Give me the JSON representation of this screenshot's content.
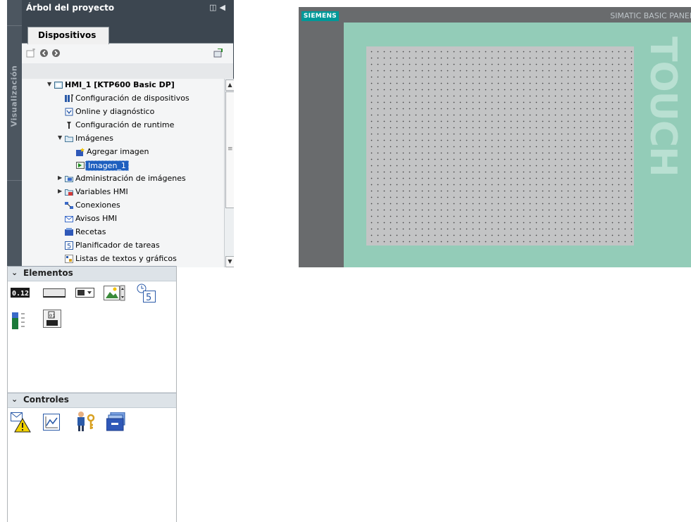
{
  "tree_panel": {
    "title": "Árbol del proyecto",
    "side_tab": "Visualización",
    "tab": "Dispositivos",
    "items": [
      {
        "label": "HMI_1 [KTP600 Basic DP]",
        "level": 0,
        "expander": "open",
        "icon": "hmi-device-icon"
      },
      {
        "label": "Configuración de dispositivos",
        "level": 1,
        "expander": "none",
        "icon": "device-config-icon"
      },
      {
        "label": "Online y diagnóstico",
        "level": 1,
        "expander": "none",
        "icon": "online-diagnostics-icon"
      },
      {
        "label": "Configuración de runtime",
        "level": 1,
        "expander": "none",
        "icon": "runtime-config-icon"
      },
      {
        "label": "Imágenes",
        "level": 1,
        "expander": "open",
        "icon": "folder-icon"
      },
      {
        "label": "Agregar imagen",
        "level": 2,
        "expander": "none",
        "icon": "add-screen-icon"
      },
      {
        "label": "Imagen_1",
        "level": 2,
        "expander": "none",
        "icon": "screen-icon",
        "selected": true
      },
      {
        "label": "Administración de imágenes",
        "level": 1,
        "expander": "closed",
        "icon": "screen-management-icon"
      },
      {
        "label": "Variables HMI",
        "level": 1,
        "expander": "closed",
        "icon": "hmi-tags-icon"
      },
      {
        "label": "Conexiones",
        "level": 1,
        "expander": "none",
        "icon": "connections-icon"
      },
      {
        "label": "Avisos HMI",
        "level": 1,
        "expander": "none",
        "icon": "hmi-alarms-icon"
      },
      {
        "label": "Recetas",
        "level": 1,
        "expander": "none",
        "icon": "recipes-icon"
      },
      {
        "label": "Planificador de tareas",
        "level": 1,
        "expander": "none",
        "icon": "scheduler-icon"
      },
      {
        "label": "Listas de textos y gráficos",
        "level": 1,
        "expander": "none",
        "icon": "text-graphic-lists-icon"
      }
    ]
  },
  "toolbox": {
    "elements_title": "Elementos",
    "controls_title": "Controles",
    "io_field_text": "0.12",
    "clock_text": "5"
  },
  "hmi_panel": {
    "brand": "SIEMENS",
    "model": "SIMATIC BASIC PANEL",
    "touch_label": "TOUCH",
    "colors": {
      "bezel": "#696b6d",
      "frame": "#93ccb8",
      "screen": "#c3c4c5",
      "brand": "#009999"
    }
  }
}
